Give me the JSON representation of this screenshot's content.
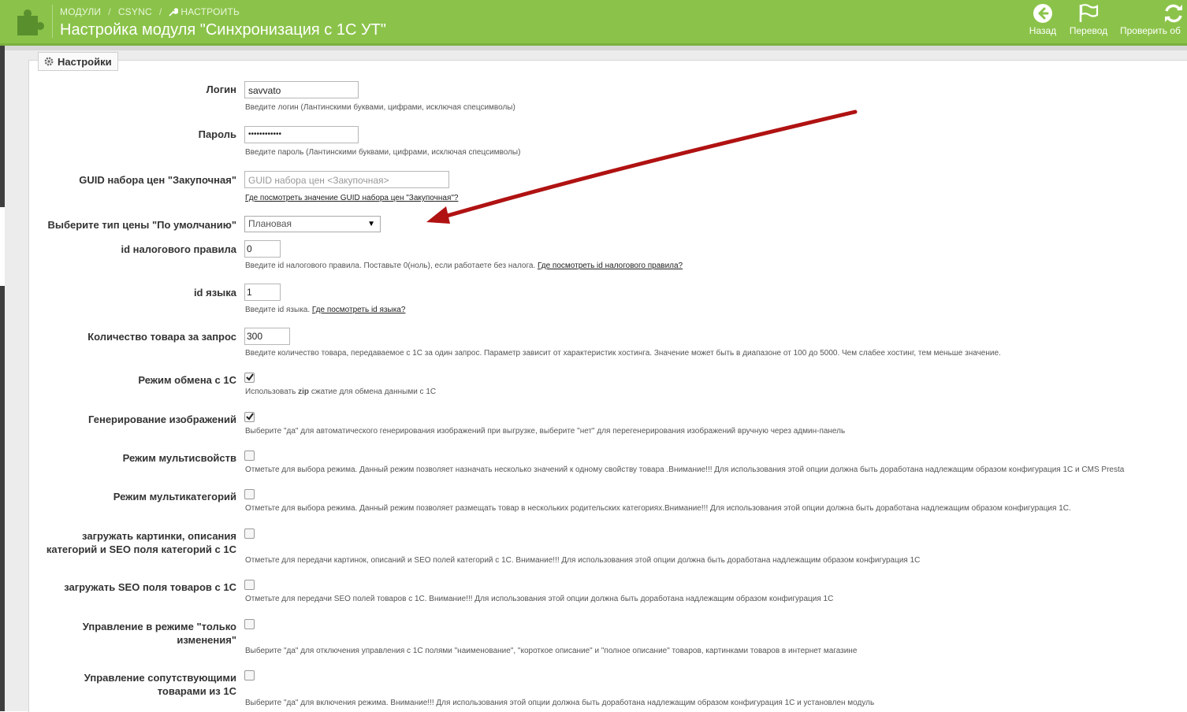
{
  "header": {
    "breadcrumb": [
      "МОДУЛИ",
      "CSYNC",
      "НАСТРОИТЬ"
    ],
    "title": "Настройка модуля \"Синхронизация с 1С УТ\"",
    "buttons": [
      {
        "label": "Назад",
        "icon": "arrow-left-circle-icon"
      },
      {
        "label": "Перевод",
        "icon": "flag-icon"
      },
      {
        "label": "Проверить об",
        "icon": "refresh-icon"
      }
    ],
    "colors": {
      "header_bg": "#8bc34a",
      "arrow": "#b01212"
    }
  },
  "panel": {
    "legend": "Настройки"
  },
  "fields": {
    "login": {
      "label": "Логин",
      "value": "savvato",
      "hint": "Введите логин (Лантинскими буквами, цифрами, исключая спецсимволы)"
    },
    "password": {
      "label": "Пароль",
      "value": "••••••••••••",
      "hint": "Введите пароль (Лантинскими буквами, цифрами, исключая спецсимволы)"
    },
    "guid": {
      "label": "GUID набора цен \"Закупочная\"",
      "placeholder": "GUID набора цен <Закупочная>",
      "hint_link": "Где посмотреть значение GUID набора цен \"Закупочная\"?"
    },
    "price_type": {
      "label": "Выберите тип цены \"По умолчанию\"",
      "value": "Плановая"
    },
    "tax_id": {
      "label": "id налогового правила",
      "value": "0",
      "hint": "Введите id налогового правила. Поставьте 0(ноль), если работаете без налога.",
      "hint_link": "Где посмотреть id налогового правила?"
    },
    "lang_id": {
      "label": "id языка",
      "value": "1",
      "hint": "Введите id языка.",
      "hint_link": "Где посмотреть id языка?"
    },
    "qty": {
      "label": "Количество товара за запрос",
      "value": "300",
      "hint": "Введите количество товара, передаваемое с 1С за один запрос. Параметр зависит от характеристик хостинга. Значение может быть в диапазоне от 100 до 5000. Чем слабее хостинг, тем меньше значение."
    },
    "exchange_mode": {
      "label": "Режим обмена с 1С",
      "checked": true,
      "hint_pre": "Использовать",
      "hint_bold": "zip",
      "hint_post": "сжатие для обмена данными с 1С"
    },
    "gen_images": {
      "label": "Генерирование изображений",
      "checked": true,
      "hint": "Выберите \"да\" для автоматического генерирования изображений при выгрузке, выберите \"нет\" для перегенерирования изображений вручную через админ-панель"
    },
    "multiprops": {
      "label": "Режим мультисвойств",
      "checked": false,
      "hint": "Отметьте для выбора режима. Данный режим позволяет назначать несколько значений к одному свойству товара .Внимание!!! Для использования этой опции должна быть доработана надлежащим образом конфигурация 1С и CMS Presta"
    },
    "multicats": {
      "label": "Режим мультикатегорий",
      "checked": false,
      "hint": "Отметьте для выбора режима. Данный режим позволяет размещать товар в нескольких родительских категориях.Внимание!!! Для использования этой опции должна быть доработана надлежащим образом конфигурация 1С."
    },
    "cat_seo": {
      "label_line1": "загружать картинки, описания",
      "label_line2": "категорий и SEO поля категорий с 1С",
      "checked": false,
      "hint": "Отметьте для передачи картинок, описаний и SEO полей категорий с 1С. Внимание!!! Для использования этой опции должна быть доработана надлежащим образом конфигурация 1С"
    },
    "prod_seo": {
      "label": "загружать SEO поля товаров с 1С",
      "checked": false,
      "hint": "Отметьте для передачи SEO полей товаров с 1С. Внимание!!! Для использования этой опции должна быть доработана надлежащим образом конфигурация 1С"
    },
    "changes_only": {
      "label_line1": "Управление в режиме \"только",
      "label_line2": "изменения\"",
      "checked": false,
      "hint": "Выберите \"да\" для отключения управления с 1С полями \"наименование\", \"короткое описание\" и \"полное описание\" товаров, картинками товаров в интернет магазине"
    },
    "related": {
      "label_line1": "Управление сопутствующими",
      "label_line2": "товарами из 1С",
      "checked": false,
      "hint": "Выберите \"да\" для включения режима. Внимание!!! Для использования этой опции должна быть доработана надлежащим образом конфигурация 1С и установлен модуль"
    }
  }
}
